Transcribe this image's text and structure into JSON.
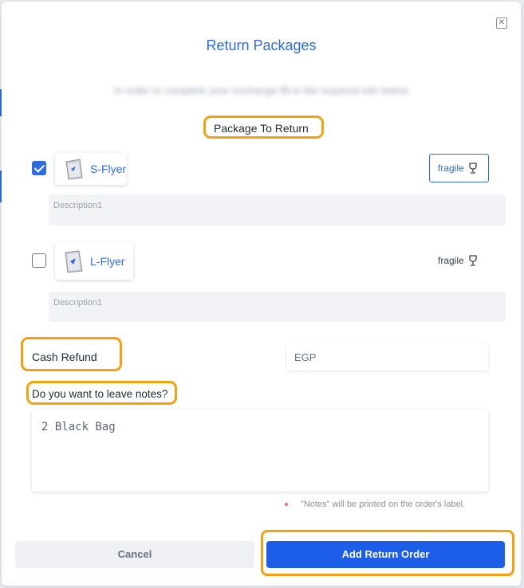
{
  "modal": {
    "title": "Return Packages",
    "subtitle": "In order to complete your exchange fill in the required info below",
    "close_icon": "close-icon"
  },
  "packages_section": {
    "label": "Package To Return"
  },
  "packages": [
    {
      "name": "S-Flyer",
      "checked": true,
      "fragile_label": "fragile",
      "description_placeholder": "Description1"
    },
    {
      "name": "L-Flyer",
      "checked": false,
      "fragile_label": "fragile",
      "description_placeholder": "Description1"
    }
  ],
  "refund": {
    "label": "Cash Refund",
    "currency_placeholder": "EGP"
  },
  "notes": {
    "label": "Do you want to leave notes?",
    "value": "2 Black Bag",
    "hint": "\"Notes\" will be printed on the order's label."
  },
  "actions": {
    "cancel_label": "Cancel",
    "submit_label": "Add Return Order"
  },
  "colors": {
    "accent": "#2d6be4",
    "highlight": "#f5a10e",
    "primary_button": "#1d5ee8"
  }
}
